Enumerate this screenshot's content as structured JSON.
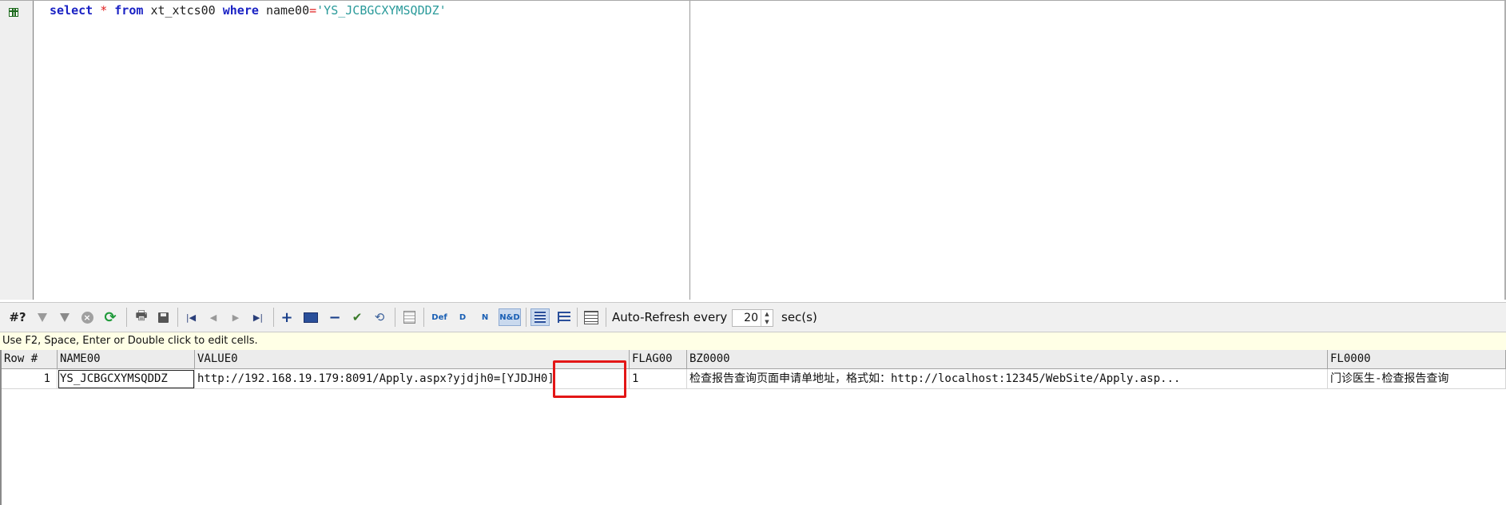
{
  "editor": {
    "sql": {
      "kw_select": "select",
      "star": "*",
      "kw_from": "from",
      "table": "xt_xtcs00",
      "kw_where": "where",
      "column": "name00",
      "equals": "=",
      "literal": "'YS_JCBGCXYMSQDDZ'"
    }
  },
  "toolbar": {
    "query_count_label": "#?",
    "auto_refresh_label": "Auto-Refresh every",
    "refresh_interval": "20",
    "refresh_unit": "sec(s)",
    "def_label": "Def",
    "d_label": "D",
    "n_label": "N",
    "nd_label": "N&D"
  },
  "hint": "Use F2, Space, Enter or Double click to edit cells.",
  "grid": {
    "columns": [
      "Row #",
      "NAME00",
      "VALUE0",
      "FLAG00",
      "BZ0000",
      "FL0000"
    ],
    "rows": [
      {
        "row_num": "1",
        "name00": "YS_JCBGCXYMSQDDZ",
        "value0": "http://192.168.19.179:8091/Apply.aspx?yjdjh0=[YJDJH0]",
        "flag00": "1",
        "bz0000": "检查报告查询页面申请单地址，格式如：http://localhost:12345/WebSite/Apply.asp...",
        "fl0000": "门诊医生-检查报告查询"
      }
    ]
  },
  "colors": {
    "keyword": "#1a22c4",
    "string": "#2a9a9a",
    "operator": "#e02020",
    "highlight_box": "#e31616",
    "hint_bg": "#ffffe6"
  }
}
